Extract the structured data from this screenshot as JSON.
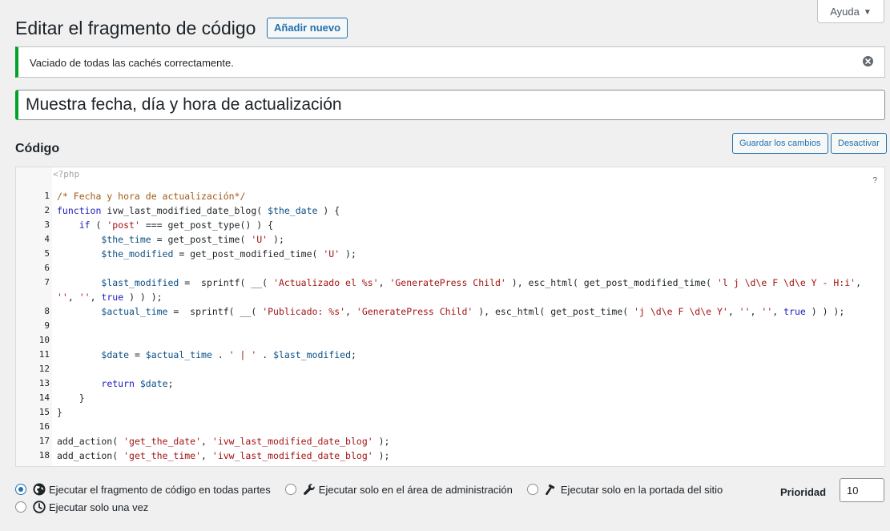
{
  "help_tab": {
    "label": "Ayuda",
    "caret": "▼"
  },
  "header": {
    "title": "Editar el fragmento de código",
    "add_new_label": "Añadir nuevo"
  },
  "notice": {
    "message": "Vaciado de todas las cachés correctamente.",
    "accent_color": "#00a32a"
  },
  "snippet": {
    "title": "Muestra fecha, día y hora de actualización"
  },
  "code_section": {
    "heading": "Código",
    "save_label": "Guardar los cambios",
    "deactivate_label": "Desactivar",
    "php_open_tag": "<?php",
    "help_marker": "?",
    "lines": [
      {
        "n": "1",
        "tokens": [
          {
            "t": "/* Fecha y hora de actualización*/",
            "c": "comment"
          }
        ]
      },
      {
        "n": "2",
        "tokens": [
          {
            "t": "function ",
            "c": "kw"
          },
          {
            "t": "ivw_last_modified_date_blog( ",
            "c": "plain"
          },
          {
            "t": "$the_date",
            "c": "var"
          },
          {
            "t": " ) {",
            "c": "plain"
          }
        ]
      },
      {
        "n": "3",
        "tokens": [
          {
            "t": "    ",
            "c": "plain"
          },
          {
            "t": "if",
            "c": "kw"
          },
          {
            "t": " ( ",
            "c": "plain"
          },
          {
            "t": "'post'",
            "c": "str"
          },
          {
            "t": " === get_post_type() ) {",
            "c": "plain"
          }
        ]
      },
      {
        "n": "4",
        "tokens": [
          {
            "t": "        ",
            "c": "plain"
          },
          {
            "t": "$the_time",
            "c": "var"
          },
          {
            "t": " = get_post_time( ",
            "c": "plain"
          },
          {
            "t": "'U'",
            "c": "str"
          },
          {
            "t": " );",
            "c": "plain"
          }
        ]
      },
      {
        "n": "5",
        "tokens": [
          {
            "t": "        ",
            "c": "plain"
          },
          {
            "t": "$the_modified",
            "c": "var"
          },
          {
            "t": " = get_post_modified_time( ",
            "c": "plain"
          },
          {
            "t": "'U'",
            "c": "str"
          },
          {
            "t": " );",
            "c": "plain"
          }
        ]
      },
      {
        "n": "6",
        "tokens": [
          {
            "t": "",
            "c": "plain"
          }
        ]
      },
      {
        "n": "7",
        "wrap": true,
        "tokens": [
          {
            "t": "        ",
            "c": "plain"
          },
          {
            "t": "$last_modified",
            "c": "var"
          },
          {
            "t": " =  sprintf( __( ",
            "c": "plain"
          },
          {
            "t": "'Actualizado el %s'",
            "c": "str"
          },
          {
            "t": ", ",
            "c": "plain"
          },
          {
            "t": "'GeneratePress Child'",
            "c": "str"
          },
          {
            "t": " ), esc_html( get_post_modified_time( ",
            "c": "plain"
          },
          {
            "t": "'l j \\d\\e F \\d\\e Y - H:i'",
            "c": "str"
          },
          {
            "t": ", ",
            "c": "plain"
          },
          {
            "t": "''",
            "c": "str"
          },
          {
            "t": ", ",
            "c": "plain"
          },
          {
            "t": "''",
            "c": "str"
          },
          {
            "t": ", ",
            "c": "plain"
          },
          {
            "t": "true",
            "c": "kw"
          },
          {
            "t": " ) ) );",
            "c": "plain"
          }
        ]
      },
      {
        "n": "8",
        "tokens": [
          {
            "t": "        ",
            "c": "plain"
          },
          {
            "t": "$actual_time",
            "c": "var"
          },
          {
            "t": " =  sprintf( __( ",
            "c": "plain"
          },
          {
            "t": "'Publicado: %s'",
            "c": "str"
          },
          {
            "t": ", ",
            "c": "plain"
          },
          {
            "t": "'GeneratePress Child'",
            "c": "str"
          },
          {
            "t": " ), esc_html( get_post_time( ",
            "c": "plain"
          },
          {
            "t": "'j \\d\\e F \\d\\e Y'",
            "c": "str"
          },
          {
            "t": ", ",
            "c": "plain"
          },
          {
            "t": "''",
            "c": "str"
          },
          {
            "t": ", ",
            "c": "plain"
          },
          {
            "t": "''",
            "c": "str"
          },
          {
            "t": ", ",
            "c": "plain"
          },
          {
            "t": "true",
            "c": "kw"
          },
          {
            "t": " ) ) );",
            "c": "plain"
          }
        ]
      },
      {
        "n": "9",
        "tokens": [
          {
            "t": "",
            "c": "plain"
          }
        ]
      },
      {
        "n": "10",
        "tokens": [
          {
            "t": "",
            "c": "plain"
          }
        ]
      },
      {
        "n": "11",
        "tokens": [
          {
            "t": "        ",
            "c": "plain"
          },
          {
            "t": "$date",
            "c": "var"
          },
          {
            "t": " = ",
            "c": "plain"
          },
          {
            "t": "$actual_time",
            "c": "var"
          },
          {
            "t": " . ",
            "c": "plain"
          },
          {
            "t": "' | '",
            "c": "str"
          },
          {
            "t": " . ",
            "c": "plain"
          },
          {
            "t": "$last_modified",
            "c": "var"
          },
          {
            "t": ";",
            "c": "plain"
          }
        ]
      },
      {
        "n": "12",
        "tokens": [
          {
            "t": "",
            "c": "plain"
          }
        ]
      },
      {
        "n": "13",
        "tokens": [
          {
            "t": "        ",
            "c": "plain"
          },
          {
            "t": "return",
            "c": "kw"
          },
          {
            "t": " ",
            "c": "plain"
          },
          {
            "t": "$date",
            "c": "var"
          },
          {
            "t": ";",
            "c": "plain"
          }
        ]
      },
      {
        "n": "14",
        "tokens": [
          {
            "t": "    }",
            "c": "plain"
          }
        ]
      },
      {
        "n": "15",
        "tokens": [
          {
            "t": "}",
            "c": "plain"
          }
        ]
      },
      {
        "n": "16",
        "tokens": [
          {
            "t": "",
            "c": "plain"
          }
        ]
      },
      {
        "n": "17",
        "tokens": [
          {
            "t": "add_action( ",
            "c": "plain"
          },
          {
            "t": "'get_the_date'",
            "c": "str"
          },
          {
            "t": ", ",
            "c": "plain"
          },
          {
            "t": "'ivw_last_modified_date_blog'",
            "c": "str"
          },
          {
            "t": " );",
            "c": "plain"
          }
        ]
      },
      {
        "n": "18",
        "tokens": [
          {
            "t": "add_action( ",
            "c": "plain"
          },
          {
            "t": "'get_the_time'",
            "c": "str"
          },
          {
            "t": ", ",
            "c": "plain"
          },
          {
            "t": "'ivw_last_modified_date_blog'",
            "c": "str"
          },
          {
            "t": " );",
            "c": "plain"
          }
        ]
      }
    ]
  },
  "scope": {
    "options": [
      {
        "label": "Ejecutar el fragmento de código en todas partes",
        "icon": "globe-icon",
        "checked": true
      },
      {
        "label": "Ejecutar solo en el área de administración",
        "icon": "wrench-icon",
        "checked": false
      },
      {
        "label": "Ejecutar solo en la portada del sitio",
        "icon": "hammer-icon",
        "checked": false
      },
      {
        "label": "Ejecutar solo una vez",
        "icon": "clock-icon",
        "checked": false
      }
    ]
  },
  "priority": {
    "label": "Prioridad",
    "value": "10"
  }
}
